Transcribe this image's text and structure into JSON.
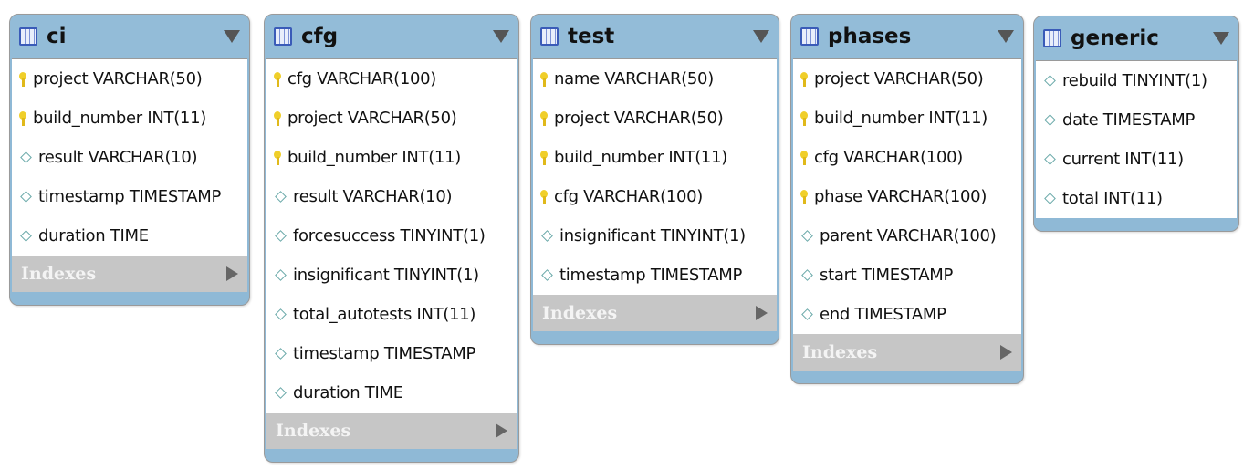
{
  "indexes_label": "Indexes",
  "colors": {
    "header": "#93bcd8",
    "key": "#f0cf2a",
    "column_marker": "#6aa9a9",
    "indexes_bar": "#c6c6c6"
  },
  "tables": [
    {
      "name": "ci",
      "indexes": true,
      "columns": [
        {
          "text": "project VARCHAR(50)",
          "pk": true
        },
        {
          "text": "build_number INT(11)",
          "pk": true
        },
        {
          "text": "result VARCHAR(10)",
          "pk": false
        },
        {
          "text": "timestamp TIMESTAMP",
          "pk": false
        },
        {
          "text": "duration TIME",
          "pk": false
        }
      ]
    },
    {
      "name": "cfg",
      "indexes": true,
      "columns": [
        {
          "text": "cfg VARCHAR(100)",
          "pk": true
        },
        {
          "text": "project VARCHAR(50)",
          "pk": true
        },
        {
          "text": "build_number INT(11)",
          "pk": true
        },
        {
          "text": "result VARCHAR(10)",
          "pk": false
        },
        {
          "text": "forcesuccess TINYINT(1)",
          "pk": false
        },
        {
          "text": "insignificant TINYINT(1)",
          "pk": false
        },
        {
          "text": "total_autotests INT(11)",
          "pk": false
        },
        {
          "text": "timestamp TIMESTAMP",
          "pk": false
        },
        {
          "text": "duration TIME",
          "pk": false
        }
      ]
    },
    {
      "name": "test",
      "indexes": true,
      "columns": [
        {
          "text": "name VARCHAR(50)",
          "pk": true
        },
        {
          "text": "project VARCHAR(50)",
          "pk": true
        },
        {
          "text": "build_number INT(11)",
          "pk": true
        },
        {
          "text": "cfg VARCHAR(100)",
          "pk": true
        },
        {
          "text": "insignificant TINYINT(1)",
          "pk": false
        },
        {
          "text": "timestamp TIMESTAMP",
          "pk": false
        }
      ]
    },
    {
      "name": "phases",
      "indexes": true,
      "columns": [
        {
          "text": "project VARCHAR(50)",
          "pk": true
        },
        {
          "text": "build_number INT(11)",
          "pk": true
        },
        {
          "text": "cfg VARCHAR(100)",
          "pk": true
        },
        {
          "text": "phase VARCHAR(100)",
          "pk": true
        },
        {
          "text": "parent VARCHAR(100)",
          "pk": false
        },
        {
          "text": "start TIMESTAMP",
          "pk": false
        },
        {
          "text": "end TIMESTAMP",
          "pk": false
        }
      ]
    },
    {
      "name": "generic",
      "indexes": false,
      "columns": [
        {
          "text": "rebuild TINYINT(1)",
          "pk": false
        },
        {
          "text": "date TIMESTAMP",
          "pk": false
        },
        {
          "text": "current INT(11)",
          "pk": false
        },
        {
          "text": "total INT(11)",
          "pk": false
        }
      ]
    }
  ]
}
